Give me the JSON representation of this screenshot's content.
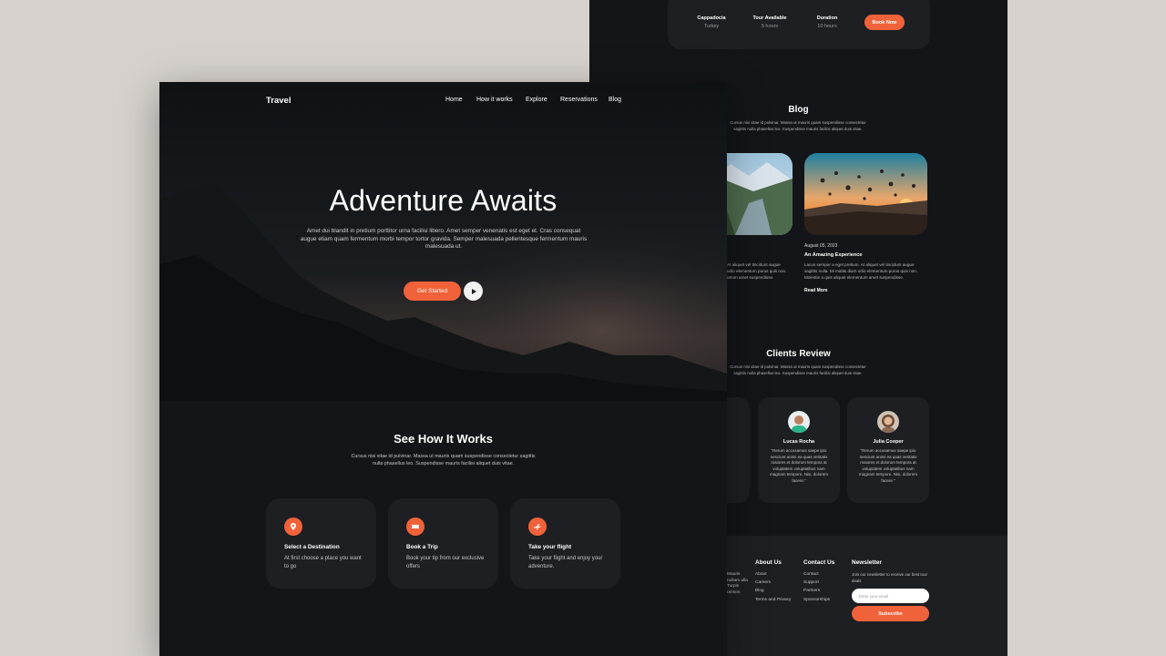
{
  "booking": {
    "items": [
      {
        "label": "Cappadocia",
        "value": "Turkey"
      },
      {
        "label": "Tour Available",
        "value": "5 hours"
      },
      {
        "label": "Duration",
        "value": "10 hours"
      }
    ],
    "button": "Book Now"
  },
  "blog": {
    "title": "Blog",
    "description": "Cursus nisi vitae id pulvinar. Massa ut mauris quam suspendisse consectetur sagittis nulla phasellus leo. Suspendisse mauris facilisi aliquet duis vitae.",
    "partial_lines": [
      "At aliquet vel tincidunt augue",
      "udio elementum purus quis non.",
      "utrum amet suspendisse."
    ],
    "post": {
      "date": "August 05, 2023",
      "title": "An Amazing Experience",
      "text": "Lacus semper a eget pretium. At aliquet vel tincidunt augue sagittis nulla. Mi mattis diam odio elementum purus quis non. Molestie a quis aliquet elementum amet suspendisse.",
      "read_more": "Read More"
    }
  },
  "reviews": {
    "title": "Clients Review",
    "description": "Cursus nisi vitae id pulvinar. Massa ut mauris quam suspendisse consectetur sagittis nulla phasellus leo. Suspendisse mauris facilisi aliquet duis vitae.",
    "items": [
      {
        "name": "Lucas Rocha",
        "quote": "\"Rerum accusamus saepe ipio nesciunt animi ea quas veritatis maiores et dolorum tempora at voluptatem voluptatibus nam magnam tempore. Nisi, dolorem facere.\""
      },
      {
        "name": "Julia Cooper",
        "quote": "\"Rerum accusamus saepe ipio nesciunt animi ea quas veritatis maiores et dolorum tempora at voluptatem voluptatibus nam magnam tempore. Nisi, dolorem facere.\""
      }
    ]
  },
  "footer": {
    "partial_text": "Mauris nullam ulla Turpis omson",
    "about": {
      "title": "About Us",
      "links": [
        "About",
        "Careers",
        "Blog",
        "Terms and Privacy"
      ]
    },
    "contact": {
      "title": "Contact Us",
      "links": [
        "Contact",
        "Support",
        "Partners",
        "Sponsorships"
      ]
    },
    "newsletter": {
      "title": "Newsletter",
      "text": "Join our newsletter to receive our best tour deals",
      "placeholder": "Enter your email",
      "button": "Subscribe"
    }
  },
  "front": {
    "logo": "Travel",
    "nav": [
      "Home",
      "How it works",
      "Explore",
      "Reservations",
      "Blog"
    ],
    "hero": {
      "title": "Adventure Awaits",
      "description": "Amet dui blandit in pretium porttitor urna facilisi libero. Amet semper venenatis est eget et. Cras consequat augue etiam quam fermentum morbi tempor tortor gravida. Semper malesuada pellentesque fermentum mauris malesuada ut.",
      "cta": "Get Started"
    },
    "how": {
      "title": "See How It Works",
      "description": "Cursus nisi vitae id pulvinar. Massa ut mauris quam suspendisse consectetur sagittis nulla phasellus leo. Suspendisse mauris facilisi aliquet duis vitae.",
      "cards": [
        {
          "icon": "map-pin-icon",
          "title": "Select a Destination",
          "text": "At first choose a place you want to go"
        },
        {
          "icon": "ticket-icon",
          "title": "Book a Trip",
          "text": "Book your tip from our exclusive offers"
        },
        {
          "icon": "airplane-icon",
          "title": "Take your flight",
          "text": "Take your flight and enjoy your adventure."
        }
      ]
    }
  },
  "colors": {
    "accent": "#f0623a",
    "background": "#141518",
    "card": "#1d1f23",
    "canvas": "#d6d1cd"
  }
}
